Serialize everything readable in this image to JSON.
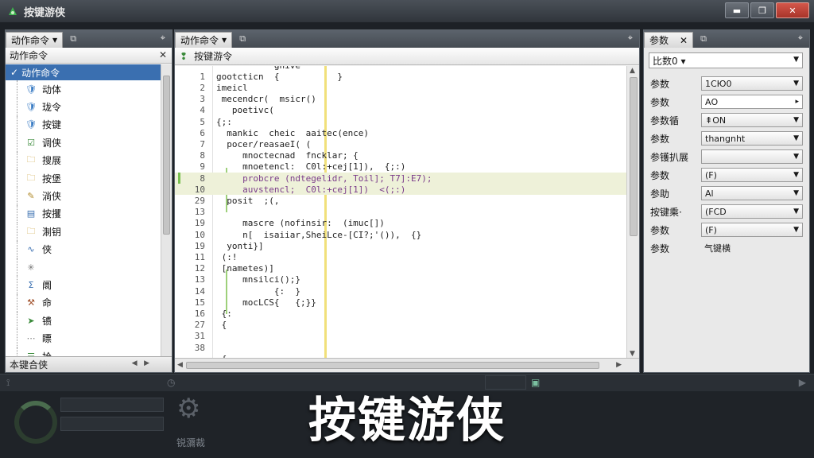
{
  "window": {
    "title": "按键游侠",
    "minimize": "▬",
    "maximize": "❐",
    "close": "✕"
  },
  "left_panel": {
    "tab_label": "动作命令",
    "subheader": "动作命令",
    "tree_root": "动作命令",
    "items": [
      {
        "label": "动体",
        "icon": "shield-icon"
      },
      {
        "label": "珑令",
        "icon": "shield-icon"
      },
      {
        "label": "按键",
        "icon": "shield-icon"
      },
      {
        "label": "调侠",
        "icon": "check-doc-icon"
      },
      {
        "label": "搜展",
        "icon": "folder-icon"
      },
      {
        "label": "按堡",
        "icon": "folder-icon"
      },
      {
        "label": "淌侠",
        "icon": "pencil-icon"
      },
      {
        "label": "按攫",
        "icon": "doc-icon"
      },
      {
        "label": "淛钥",
        "icon": "folder-icon"
      },
      {
        "label": "侠",
        "icon": "wave-icon"
      },
      {
        "label": "",
        "icon": "star-icon"
      },
      {
        "label": "阛",
        "icon": "sigma-icon"
      },
      {
        "label": "命",
        "icon": "tool-icon"
      },
      {
        "label": "镄",
        "icon": "arrow-icon"
      },
      {
        "label": "瞟",
        "icon": "dots-icon"
      },
      {
        "label": "拾",
        "icon": "list-icon"
      }
    ],
    "bottom_label": "本键合侠"
  },
  "center_panel": {
    "tab_label": "动作命令",
    "editor_title": "按键游令",
    "lines": [
      {
        "n": "",
        "t": "           gnive"
      },
      {
        "n": "1",
        "t": "gootcticn  {           }"
      },
      {
        "n": "2",
        "t": "imeicl"
      },
      {
        "n": "3",
        "t": " mecendcr(  msicr()"
      },
      {
        "n": "4",
        "t": "   poetivc("
      },
      {
        "n": "5",
        "t": "{;:"
      },
      {
        "n": "6",
        "t": "  mankic  cheic  aaitec(ence)"
      },
      {
        "n": "7",
        "t": "  pocer/reasaeI( ("
      },
      {
        "n": "8",
        "t": "     mnoctecnad  fncklar; {"
      },
      {
        "n": "9",
        "t": "     mnoetencl:  C0l:+cej[1]),  {;:)"
      },
      {
        "n": "8",
        "t": "     probcre (ndtegelidr, Toil]; T7]:E7);"
      },
      {
        "n": "10",
        "t": "     auvstencl;  C0l:+cej[1])  <(;:)"
      },
      {
        "n": "29",
        "t": "  posit  ;(,"
      },
      {
        "n": "13",
        "t": ""
      },
      {
        "n": "19",
        "t": "     mascre (nofinsir:  (imuc[])"
      },
      {
        "n": "10",
        "t": "     n[  isaiiar,SheiLce-[CI?;'()),  {}"
      },
      {
        "n": "19",
        "t": "  yonti}]"
      },
      {
        "n": "11",
        "t": " (:!"
      },
      {
        "n": "12",
        "t": " [nametes)]"
      },
      {
        "n": "13",
        "t": "     mnsilci();}"
      },
      {
        "n": "14",
        "t": "           {:  }"
      },
      {
        "n": "15",
        "t": "     mocLCS{   {;}}"
      },
      {
        "n": "16",
        "t": " {:"
      },
      {
        "n": "27",
        "t": " {"
      },
      {
        "n": "31",
        "t": ""
      },
      {
        "n": "38",
        "t": ""
      },
      {
        "n": "",
        "t": " {"
      }
    ]
  },
  "right_panel": {
    "tab_label": "参数",
    "top_select": "比数0 ▾",
    "rows": [
      {
        "label": "参数",
        "value": "1СЮ0",
        "type": "select"
      },
      {
        "label": "参数",
        "value": "АО",
        "type": "input"
      },
      {
        "label": "参数循",
        "value": "ON",
        "type": "stepper"
      },
      {
        "label": "参数",
        "value": "thangnht",
        "type": "select"
      },
      {
        "label": "参镬扒展",
        "value": "",
        "type": "select"
      },
      {
        "label": "参数",
        "value": "(F)",
        "type": "select"
      },
      {
        "label": "参助",
        "value": "Al",
        "type": "select"
      },
      {
        "label": "按键乘·",
        "value": "(FCD",
        "type": "select"
      },
      {
        "label": "参数",
        "value": "(F)",
        "type": "select"
      },
      {
        "label": "参数",
        "value": "气键横",
        "type": "text"
      }
    ]
  },
  "bottom_dock": {
    "label": "锐瀰裁",
    "caption": "按键游侠"
  },
  "colors": {
    "titlebar": "#3c4249",
    "selection": "#3a6fb0",
    "highlight_line": "#eef1d9",
    "code_rule": "#f1e07a",
    "close_button": "#c0463a"
  }
}
